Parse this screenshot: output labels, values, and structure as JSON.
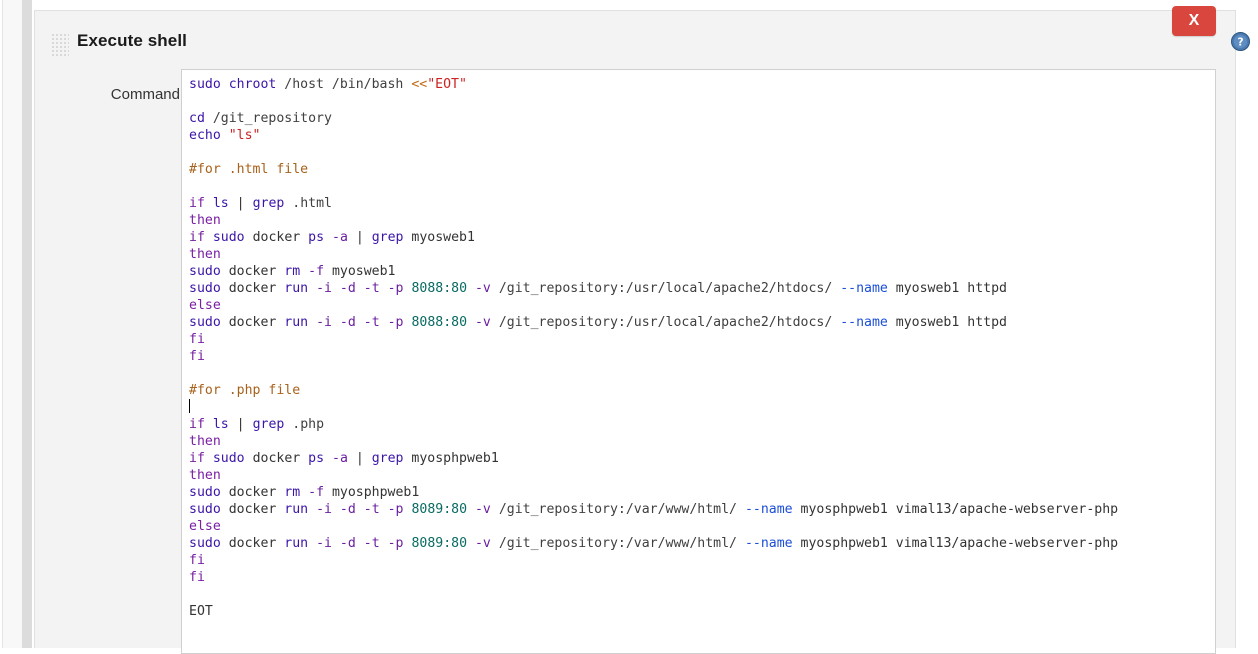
{
  "window": {
    "close_label": "X",
    "help_icon": "help-circle-icon",
    "grip_icon": "drag-grip-icon"
  },
  "step": {
    "title": "Execute shell"
  },
  "form": {
    "command_label": "Command"
  },
  "colors": {
    "close_button": "#d9463d",
    "help_icon": "#3a6ea5",
    "panel_bg": "#f3f3f3",
    "editor_bg": "#ffffff",
    "command": "#3b15a8",
    "keyword": "#7a1fa2",
    "flag": "#6a1fa0",
    "option": "#1c4fd8",
    "number": "#0a6b62",
    "string": "#cc2222",
    "comment": "#a8621b",
    "redirect": "#c06a14",
    "plain": "#333333"
  },
  "command_script": {
    "raw": "sudo chroot /host /bin/bash <<\"EOT\"\n\ncd /git_repository\necho \"ls\"\n\n#for .html file\n\nif ls | grep .html\nthen\nif sudo docker ps -a | grep myosweb1\nthen\nsudo docker rm -f myosweb1\nsudo docker run -i -d -t -p 8088:80 -v /git_repository:/usr/local/apache2/htdocs/ --name myosweb1 httpd\nelse\nsudo docker run -i -d -t -p 8088:80 -v /git_repository:/usr/local/apache2/htdocs/ --name myosweb1 httpd\nfi\nfi\n\n#for .php file\n\nif ls | grep .php\nthen\nif sudo docker ps -a | grep myosphpweb1\nthen\nsudo docker rm -f myosphpweb1\nsudo docker run -i -d -t -p 8089:80 -v /git_repository:/var/www/html/ --name myosphpweb1 vimal13/apache-webserver-php\nelse\nsudo docker run -i -d -t -p 8089:80 -v /git_repository:/var/www/html/ --name myosphpweb1 vimal13/apache-webserver-php\nfi\nfi\n\nEOT",
    "lines": [
      {
        "n": 1,
        "text": "sudo chroot /host /bin/bash <<\"EOT\"",
        "tokens": [
          {
            "t": "sudo ",
            "c": "cmd"
          },
          {
            "t": "chroot",
            "c": "cmd"
          },
          {
            "t": " /host /bin/bash ",
            "c": "path"
          },
          {
            "t": "<<",
            "c": "redir"
          },
          {
            "t": "\"EOT\"",
            "c": "str"
          }
        ]
      },
      {
        "n": 2,
        "text": "",
        "tokens": []
      },
      {
        "n": 3,
        "text": "cd /git_repository",
        "tokens": [
          {
            "t": "cd",
            "c": "cmd"
          },
          {
            "t": " /git_repository",
            "c": "path"
          }
        ]
      },
      {
        "n": 4,
        "text": "echo \"ls\"",
        "tokens": [
          {
            "t": "echo",
            "c": "cmd"
          },
          {
            "t": " ",
            "c": "plain"
          },
          {
            "t": "\"ls\"",
            "c": "str"
          }
        ]
      },
      {
        "n": 5,
        "text": "",
        "tokens": []
      },
      {
        "n": 6,
        "text": "#for .html file",
        "tokens": [
          {
            "t": "#for .html file",
            "c": "cmt"
          }
        ]
      },
      {
        "n": 7,
        "text": "",
        "tokens": []
      },
      {
        "n": 8,
        "text": "if ls | grep .html",
        "tokens": [
          {
            "t": "if",
            "c": "kw"
          },
          {
            "t": " ",
            "c": "plain"
          },
          {
            "t": "ls",
            "c": "cmd"
          },
          {
            "t": " | ",
            "c": "plain"
          },
          {
            "t": "grep",
            "c": "cmd"
          },
          {
            "t": " .html",
            "c": "path"
          }
        ]
      },
      {
        "n": 9,
        "text": "then",
        "tokens": [
          {
            "t": "then",
            "c": "kw"
          }
        ]
      },
      {
        "n": 10,
        "text": "if sudo docker ps -a | grep myosweb1",
        "tokens": [
          {
            "t": "if",
            "c": "kw"
          },
          {
            "t": " ",
            "c": "plain"
          },
          {
            "t": "sudo",
            "c": "cmd"
          },
          {
            "t": " ",
            "c": "plain"
          },
          {
            "t": "docker",
            "c": "plain"
          },
          {
            "t": " ",
            "c": "plain"
          },
          {
            "t": "ps",
            "c": "cmd"
          },
          {
            "t": " ",
            "c": "plain"
          },
          {
            "t": "-a",
            "c": "flag"
          },
          {
            "t": " | ",
            "c": "plain"
          },
          {
            "t": "grep",
            "c": "cmd"
          },
          {
            "t": " myosweb1",
            "c": "plain"
          }
        ]
      },
      {
        "n": 11,
        "text": "then",
        "tokens": [
          {
            "t": "then",
            "c": "kw"
          }
        ]
      },
      {
        "n": 12,
        "text": "sudo docker rm -f myosweb1",
        "tokens": [
          {
            "t": "sudo",
            "c": "cmd"
          },
          {
            "t": " docker ",
            "c": "plain"
          },
          {
            "t": "rm",
            "c": "cmd"
          },
          {
            "t": " ",
            "c": "plain"
          },
          {
            "t": "-f",
            "c": "flag"
          },
          {
            "t": " myosweb1",
            "c": "plain"
          }
        ]
      },
      {
        "n": 13,
        "text": "sudo docker run -i -d -t -p 8088:80 -v /git_repository:/usr/local/apache2/htdocs/ --name myosweb1 httpd",
        "tokens": [
          {
            "t": "sudo",
            "c": "cmd"
          },
          {
            "t": " docker ",
            "c": "plain"
          },
          {
            "t": "run",
            "c": "cmd"
          },
          {
            "t": " ",
            "c": "plain"
          },
          {
            "t": "-i",
            "c": "flag"
          },
          {
            "t": " ",
            "c": "plain"
          },
          {
            "t": "-d",
            "c": "flag"
          },
          {
            "t": " ",
            "c": "plain"
          },
          {
            "t": "-t",
            "c": "flag"
          },
          {
            "t": " ",
            "c": "plain"
          },
          {
            "t": "-p",
            "c": "flag"
          },
          {
            "t": " ",
            "c": "plain"
          },
          {
            "t": "8088:80",
            "c": "num"
          },
          {
            "t": " ",
            "c": "plain"
          },
          {
            "t": "-v",
            "c": "flag"
          },
          {
            "t": " /git_repository:/usr/local/apache2/htdocs/ ",
            "c": "path"
          },
          {
            "t": "--name",
            "c": "opt"
          },
          {
            "t": " myosweb1 httpd",
            "c": "plain"
          }
        ]
      },
      {
        "n": 14,
        "text": "else",
        "tokens": [
          {
            "t": "else",
            "c": "kw"
          }
        ]
      },
      {
        "n": 15,
        "text": "sudo docker run -i -d -t -p 8088:80 -v /git_repository:/usr/local/apache2/htdocs/ --name myosweb1 httpd",
        "tokens": [
          {
            "t": "sudo",
            "c": "cmd"
          },
          {
            "t": " docker ",
            "c": "plain"
          },
          {
            "t": "run",
            "c": "cmd"
          },
          {
            "t": " ",
            "c": "plain"
          },
          {
            "t": "-i",
            "c": "flag"
          },
          {
            "t": " ",
            "c": "plain"
          },
          {
            "t": "-d",
            "c": "flag"
          },
          {
            "t": " ",
            "c": "plain"
          },
          {
            "t": "-t",
            "c": "flag"
          },
          {
            "t": " ",
            "c": "plain"
          },
          {
            "t": "-p",
            "c": "flag"
          },
          {
            "t": " ",
            "c": "plain"
          },
          {
            "t": "8088:80",
            "c": "num"
          },
          {
            "t": " ",
            "c": "plain"
          },
          {
            "t": "-v",
            "c": "flag"
          },
          {
            "t": " /git_repository:/usr/local/apache2/htdocs/ ",
            "c": "path"
          },
          {
            "t": "--name",
            "c": "opt"
          },
          {
            "t": " myosweb1 httpd",
            "c": "plain"
          }
        ]
      },
      {
        "n": 16,
        "text": "fi",
        "tokens": [
          {
            "t": "fi",
            "c": "kw"
          }
        ]
      },
      {
        "n": 17,
        "text": "fi",
        "tokens": [
          {
            "t": "fi",
            "c": "kw"
          }
        ]
      },
      {
        "n": 18,
        "text": "",
        "tokens": []
      },
      {
        "n": 19,
        "text": "#for .php file",
        "tokens": [
          {
            "t": "#for .php file",
            "c": "cmt"
          }
        ]
      },
      {
        "n": 20,
        "text": "",
        "tokens": [],
        "caret": true
      },
      {
        "n": 21,
        "text": "if ls | grep .php",
        "tokens": [
          {
            "t": "if",
            "c": "kw"
          },
          {
            "t": " ",
            "c": "plain"
          },
          {
            "t": "ls",
            "c": "cmd"
          },
          {
            "t": " | ",
            "c": "plain"
          },
          {
            "t": "grep",
            "c": "cmd"
          },
          {
            "t": " .php",
            "c": "path"
          }
        ]
      },
      {
        "n": 22,
        "text": "then",
        "tokens": [
          {
            "t": "then",
            "c": "kw"
          }
        ]
      },
      {
        "n": 23,
        "text": "if sudo docker ps -a | grep myosphpweb1",
        "tokens": [
          {
            "t": "if",
            "c": "kw"
          },
          {
            "t": " ",
            "c": "plain"
          },
          {
            "t": "sudo",
            "c": "cmd"
          },
          {
            "t": " ",
            "c": "plain"
          },
          {
            "t": "docker",
            "c": "plain"
          },
          {
            "t": " ",
            "c": "plain"
          },
          {
            "t": "ps",
            "c": "cmd"
          },
          {
            "t": " ",
            "c": "plain"
          },
          {
            "t": "-a",
            "c": "flag"
          },
          {
            "t": " | ",
            "c": "plain"
          },
          {
            "t": "grep",
            "c": "cmd"
          },
          {
            "t": " myosphpweb1",
            "c": "plain"
          }
        ]
      },
      {
        "n": 24,
        "text": "then",
        "tokens": [
          {
            "t": "then",
            "c": "kw"
          }
        ]
      },
      {
        "n": 25,
        "text": "sudo docker rm -f myosphpweb1",
        "tokens": [
          {
            "t": "sudo",
            "c": "cmd"
          },
          {
            "t": " docker ",
            "c": "plain"
          },
          {
            "t": "rm",
            "c": "cmd"
          },
          {
            "t": " ",
            "c": "plain"
          },
          {
            "t": "-f",
            "c": "flag"
          },
          {
            "t": " myosphpweb1",
            "c": "plain"
          }
        ]
      },
      {
        "n": 26,
        "text": "sudo docker run -i -d -t -p 8089:80 -v /git_repository:/var/www/html/ --name myosphpweb1 vimal13/apache-webserver-php",
        "tokens": [
          {
            "t": "sudo",
            "c": "cmd"
          },
          {
            "t": " docker ",
            "c": "plain"
          },
          {
            "t": "run",
            "c": "cmd"
          },
          {
            "t": " ",
            "c": "plain"
          },
          {
            "t": "-i",
            "c": "flag"
          },
          {
            "t": " ",
            "c": "plain"
          },
          {
            "t": "-d",
            "c": "flag"
          },
          {
            "t": " ",
            "c": "plain"
          },
          {
            "t": "-t",
            "c": "flag"
          },
          {
            "t": " ",
            "c": "plain"
          },
          {
            "t": "-p",
            "c": "flag"
          },
          {
            "t": " ",
            "c": "plain"
          },
          {
            "t": "8089:80",
            "c": "num"
          },
          {
            "t": " ",
            "c": "plain"
          },
          {
            "t": "-v",
            "c": "flag"
          },
          {
            "t": " /git_repository:/var/www/html/ ",
            "c": "path"
          },
          {
            "t": "--name",
            "c": "opt"
          },
          {
            "t": " myosphpweb1 vimal13/apache-webserver-php",
            "c": "plain"
          }
        ]
      },
      {
        "n": 27,
        "text": "else",
        "tokens": [
          {
            "t": "else",
            "c": "kw"
          }
        ]
      },
      {
        "n": 28,
        "text": "sudo docker run -i -d -t -p 8089:80 -v /git_repository:/var/www/html/ --name myosphpweb1 vimal13/apache-webserver-php",
        "tokens": [
          {
            "t": "sudo",
            "c": "cmd"
          },
          {
            "t": " docker ",
            "c": "plain"
          },
          {
            "t": "run",
            "c": "cmd"
          },
          {
            "t": " ",
            "c": "plain"
          },
          {
            "t": "-i",
            "c": "flag"
          },
          {
            "t": " ",
            "c": "plain"
          },
          {
            "t": "-d",
            "c": "flag"
          },
          {
            "t": " ",
            "c": "plain"
          },
          {
            "t": "-t",
            "c": "flag"
          },
          {
            "t": " ",
            "c": "plain"
          },
          {
            "t": "-p",
            "c": "flag"
          },
          {
            "t": " ",
            "c": "plain"
          },
          {
            "t": "8089:80",
            "c": "num"
          },
          {
            "t": " ",
            "c": "plain"
          },
          {
            "t": "-v",
            "c": "flag"
          },
          {
            "t": " /git_repository:/var/www/html/ ",
            "c": "path"
          },
          {
            "t": "--name",
            "c": "opt"
          },
          {
            "t": " myosphpweb1 vimal13/apache-webserver-php",
            "c": "plain"
          }
        ]
      },
      {
        "n": 29,
        "text": "fi",
        "tokens": [
          {
            "t": "fi",
            "c": "kw"
          }
        ]
      },
      {
        "n": 30,
        "text": "fi",
        "tokens": [
          {
            "t": "fi",
            "c": "kw"
          }
        ]
      },
      {
        "n": 31,
        "text": "",
        "tokens": []
      },
      {
        "n": 32,
        "text": "EOT",
        "tokens": [
          {
            "t": "EOT",
            "c": "plain"
          }
        ]
      }
    ]
  }
}
